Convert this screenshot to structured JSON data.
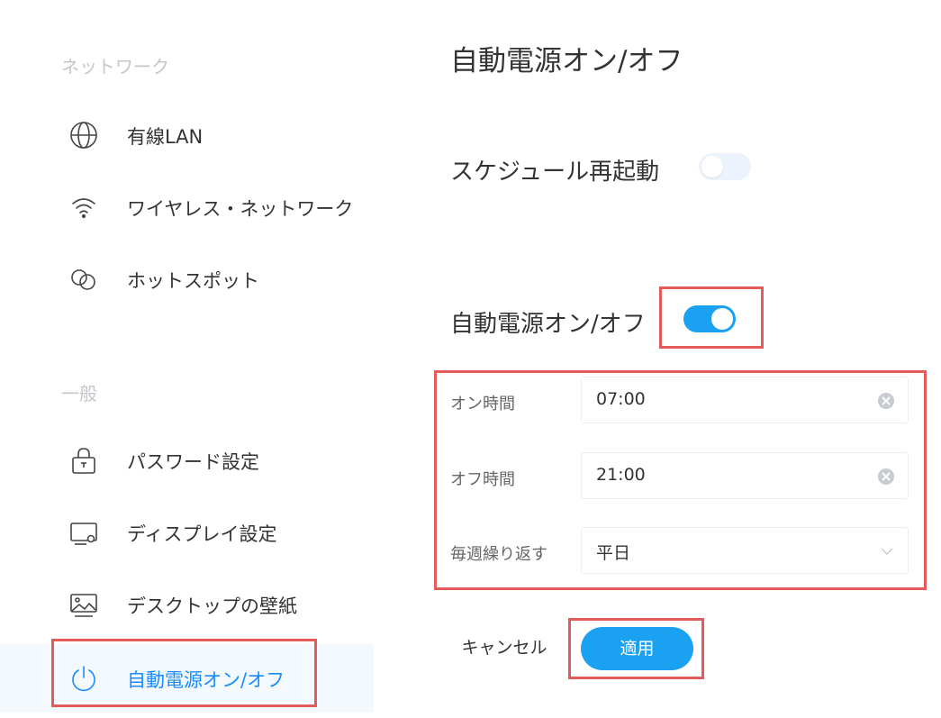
{
  "sidebar": {
    "sections": [
      {
        "label": "ネットワーク",
        "items": [
          {
            "label": "有線LAN",
            "icon": "globe-icon"
          },
          {
            "label": "ワイヤレス・ネットワーク",
            "icon": "wifi-icon"
          },
          {
            "label": "ホットスポット",
            "icon": "hotspot-icon"
          }
        ]
      },
      {
        "label": "一般",
        "items": [
          {
            "label": "パスワード設定",
            "icon": "lock-icon"
          },
          {
            "label": "ディスプレイ設定",
            "icon": "display-settings-icon"
          },
          {
            "label": "デスクトップの壁紙",
            "icon": "wallpaper-icon"
          },
          {
            "label": "自動電源オン/オフ",
            "icon": "power-icon",
            "active": true
          }
        ]
      }
    ]
  },
  "main": {
    "title": "自動電源オン/オフ",
    "schedule_restart": {
      "label": "スケジュール再起動",
      "enabled": false
    },
    "auto_power": {
      "label": "自動電源オン/オフ",
      "enabled": true
    },
    "fields": [
      {
        "label": "オン時間",
        "value": "07:00",
        "icon": "clear-icon"
      },
      {
        "label": "オフ時間",
        "value": "21:00",
        "icon": "clear-icon"
      },
      {
        "label": "毎週繰り返す",
        "value": "平日",
        "icon": "chevron-down-icon"
      }
    ],
    "cancel_label": "キャンセル",
    "apply_label": "適用"
  },
  "colors": {
    "accent": "#1aa1f2",
    "active_text": "#1a8cff",
    "highlight_border": "#e35b5b",
    "section_label": "#c4c7cc"
  }
}
